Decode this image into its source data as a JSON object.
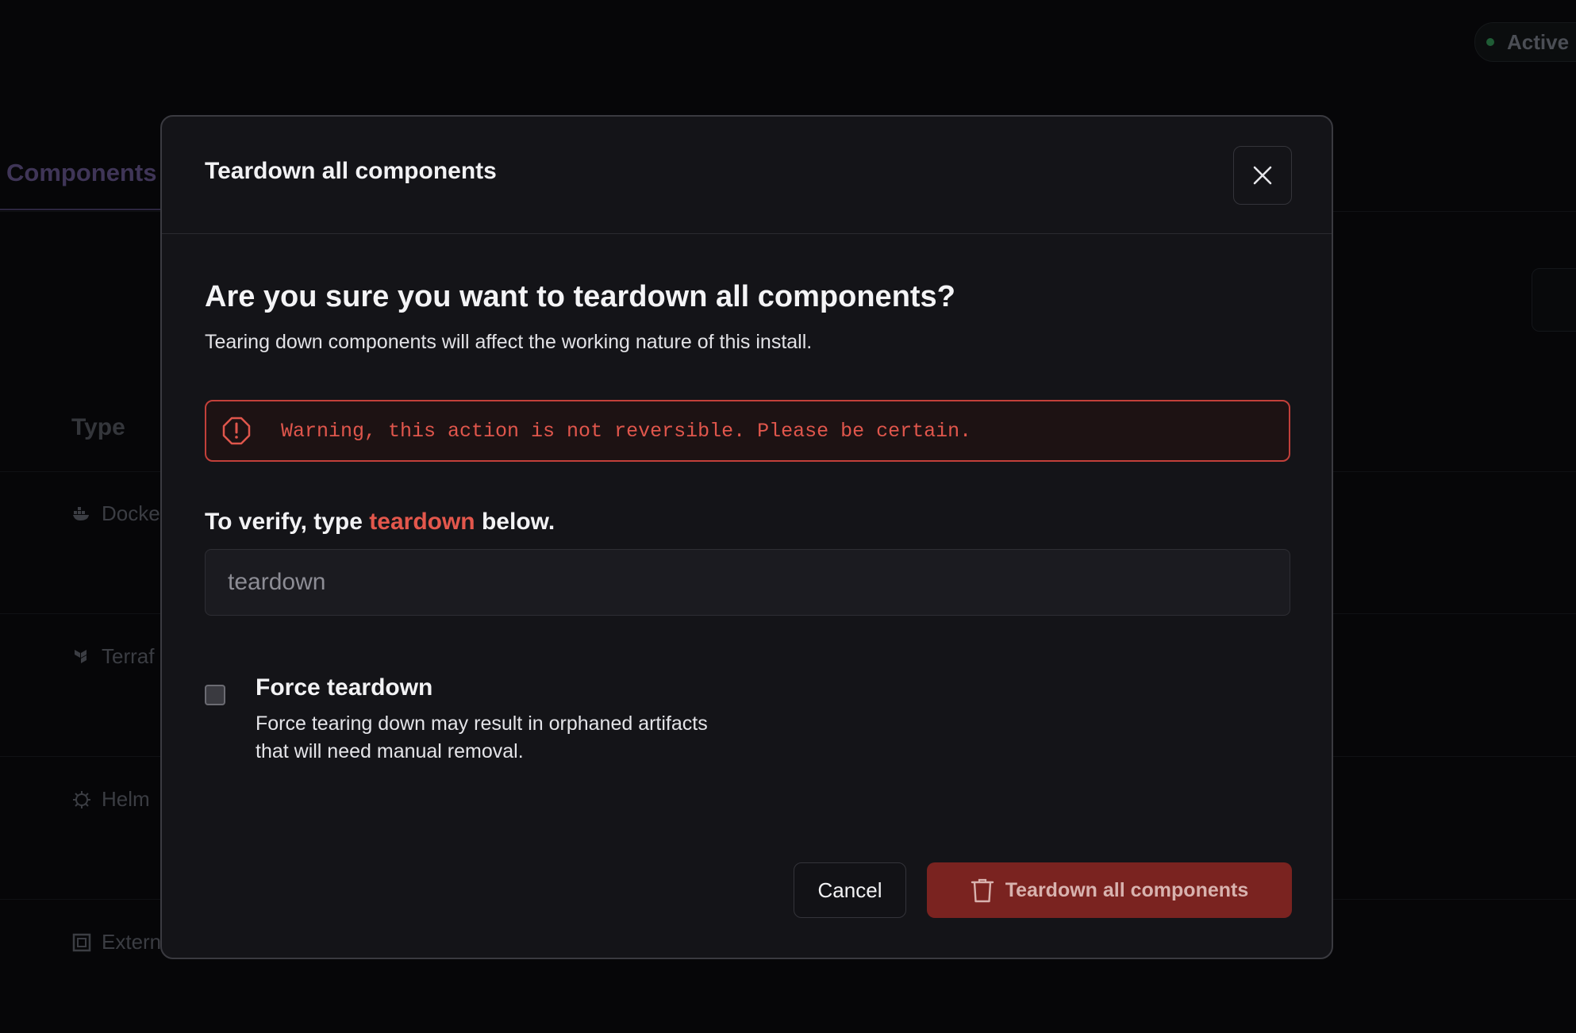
{
  "background": {
    "status_badge": "Active",
    "tab": "Components",
    "table_header_type": "Type",
    "rows": [
      {
        "label": "Docke",
        "icon": "docker-icon"
      },
      {
        "label": "Terraf",
        "icon": "terraform-icon"
      },
      {
        "label": "Helm",
        "icon": "helm-icon"
      },
      {
        "label": "Extern",
        "icon": "external-icon"
      }
    ]
  },
  "modal": {
    "title": "Teardown all components",
    "heading": "Are you sure you want to teardown all components?",
    "subtext": "Tearing down components will affect the working nature of this install.",
    "warning": "Warning, this action is not reversible. Please be certain.",
    "verify_prefix": "To verify, type ",
    "verify_keyword": "teardown",
    "verify_suffix": " below.",
    "input_placeholder": "teardown",
    "force_label": "Force teardown",
    "force_desc": "Force tearing down may result in orphaned artifacts that will need manual removal.",
    "cancel_label": "Cancel",
    "confirm_label": "Teardown all components"
  },
  "colors": {
    "danger": "#c2403a",
    "danger_text": "#e0564c",
    "confirm_bg": "#7a2320",
    "modal_bg": "#141418"
  }
}
